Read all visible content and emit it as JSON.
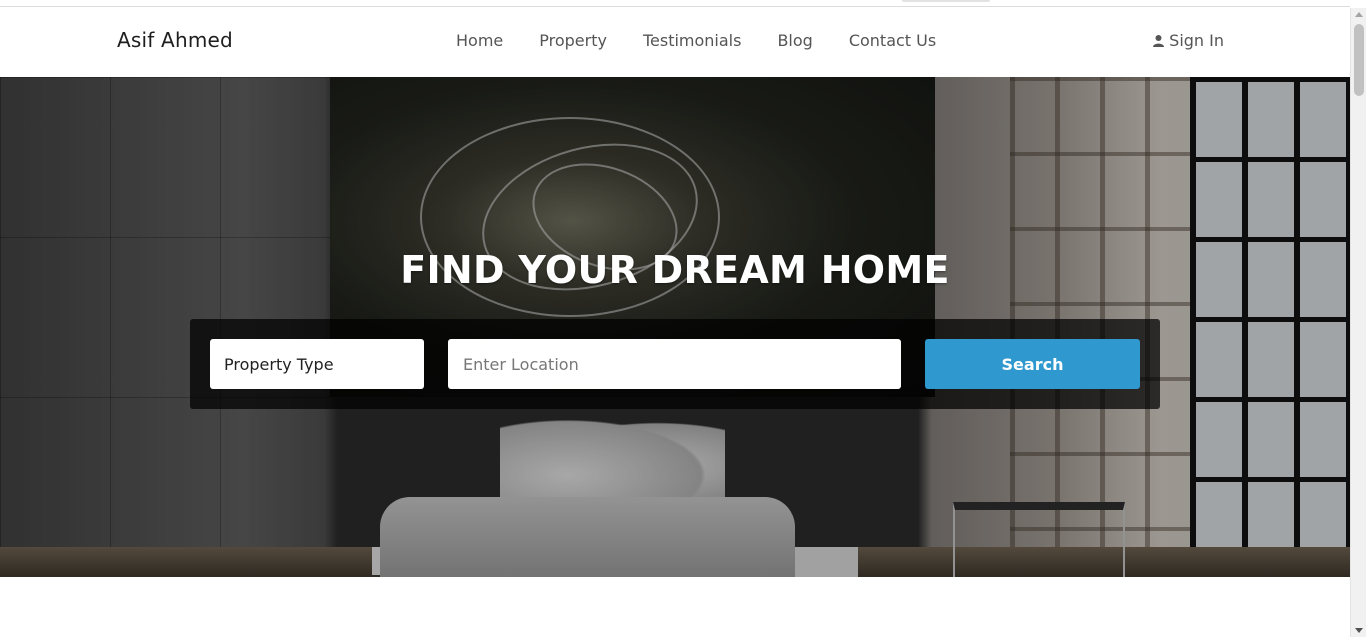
{
  "header": {
    "brand": "Asif Ahmed",
    "nav": [
      {
        "label": "Home"
      },
      {
        "label": "Property"
      },
      {
        "label": "Testimonials"
      },
      {
        "label": "Blog"
      },
      {
        "label": "Contact Us"
      }
    ],
    "signin_label": "Sign In",
    "signin_icon": "user-icon"
  },
  "hero": {
    "title": "FIND YOUR DREAM HOME",
    "property_type_label": "Property Type",
    "location_placeholder": "Enter Location",
    "search_label": "Search"
  },
  "colors": {
    "accent": "#2f98cf",
    "text": "#555555",
    "brand_text": "#1e1e1e"
  }
}
